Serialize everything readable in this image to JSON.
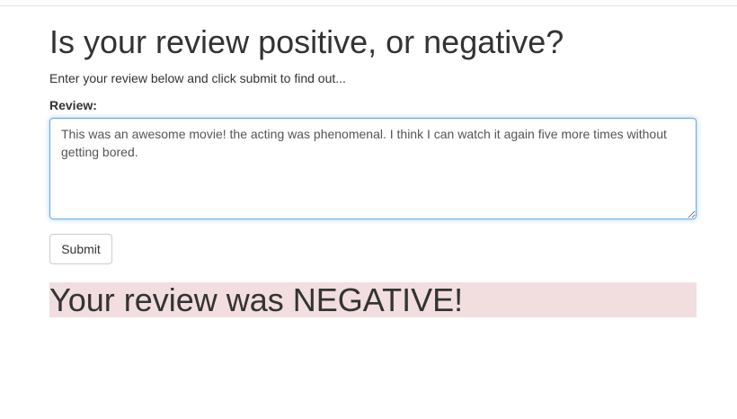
{
  "page": {
    "title": "Is your review positive, or negative?",
    "intro": "Enter your review below and click submit to find out..."
  },
  "form": {
    "label": "Review:",
    "review_value": "This was an awesome movie! the acting was phenomenal. I think I can watch it again five more times without getting bored.",
    "submit_label": "Submit"
  },
  "result": {
    "text": "Your review was NEGATIVE!",
    "background_color": "#f2dede"
  },
  "colors": {
    "focus_border": "#66afe9"
  }
}
